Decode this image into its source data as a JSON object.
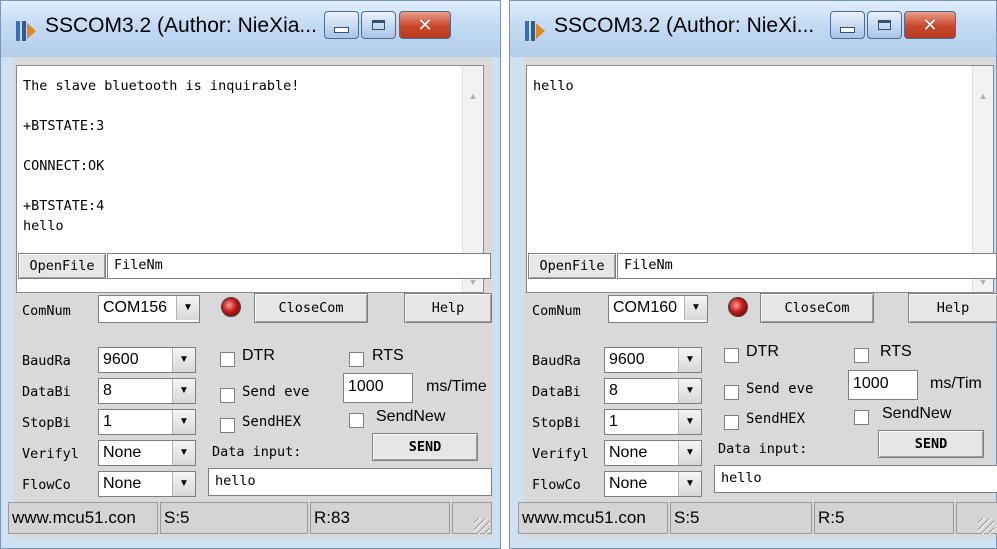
{
  "windows": [
    {
      "title": "SSCOM3.2 (Author: NieXia...",
      "output_text": "The slave bluetooth is inquirable!\n\n+BTSTATE:3\n\nCONNECT:OK\n\n+BTSTATE:4\nhello",
      "openfile_label": "OpenFile",
      "filename_value": "FileNm",
      "comnum_label": "ComNum",
      "comnum_value": "COM156",
      "closecom_label": "CloseCom",
      "help_label": "Help",
      "baudrate_label": "BaudRa",
      "baudrate_value": "9600",
      "databits_label": "DataBi",
      "databits_value": "8",
      "stopbits_label": "StopBi",
      "stopbits_value": "1",
      "verify_label": "Verifyl",
      "verify_value": "None",
      "flowcontrol_label": "FlowCo",
      "flowcontrol_value": "None",
      "dtr_label": "DTR",
      "rts_label": "RTS",
      "send_every_label": "Send eve",
      "interval_value": "1000",
      "interval_unit": "ms/Time",
      "sendhex_label": "SendHEX",
      "sendnew_label": "SendNew",
      "data_input_label": "Data input:",
      "send_label": "SEND",
      "data_input_value": "hello",
      "status_site": "www.mcu51.con",
      "status_sent": "S:5",
      "status_received": "R:83"
    },
    {
      "title": "SSCOM3.2 (Author: NieXi...",
      "output_text": "hello",
      "openfile_label": "OpenFile",
      "filename_value": "FileNm",
      "comnum_label": "ComNum",
      "comnum_value": "COM160",
      "closecom_label": "CloseCom",
      "help_label": "Help",
      "baudrate_label": "BaudRa",
      "baudrate_value": "9600",
      "databits_label": "DataBi",
      "databits_value": "8",
      "stopbits_label": "StopBi",
      "stopbits_value": "1",
      "verify_label": "Verifyl",
      "verify_value": "None",
      "flowcontrol_label": "FlowCo",
      "flowcontrol_value": "None",
      "dtr_label": "DTR",
      "rts_label": "RTS",
      "send_every_label": "Send eve",
      "interval_value": "1000",
      "interval_unit": "ms/Tim",
      "sendhex_label": "SendHEX",
      "sendnew_label": "SendNew",
      "data_input_label": "Data input:",
      "send_label": "SEND",
      "data_input_value": "hello",
      "status_site": "www.mcu51.con",
      "status_sent": "S:5",
      "status_received": "R:5"
    }
  ],
  "icons": {
    "app": "sscom-app-icon",
    "minimize": "minimize-icon",
    "maximize": "maximize-icon",
    "close": "close-icon",
    "led": "port-status-led-icon",
    "dropdown": "chevron-down-icon",
    "resize": "resize-grip-icon"
  },
  "colors": {
    "title_bar": "#c3daf3",
    "close_button": "#c9472c",
    "led": "#c01818",
    "panel": "#d9d9d9"
  }
}
